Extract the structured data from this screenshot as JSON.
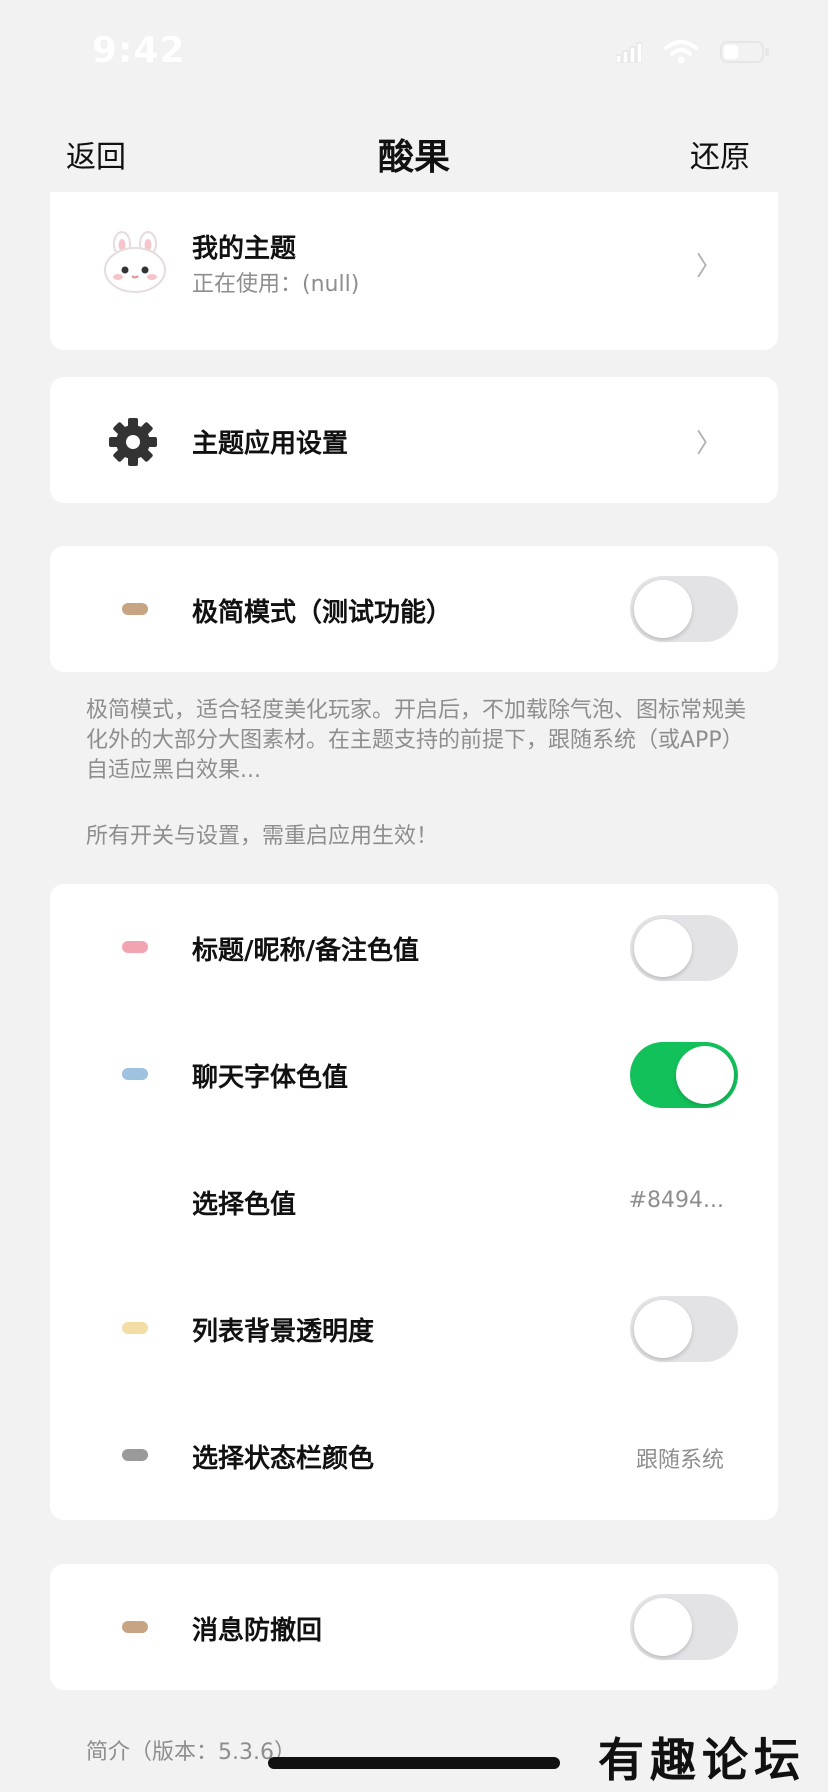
{
  "status_bar": {
    "time": "9:42"
  },
  "nav": {
    "back": "返回",
    "title": "酸果",
    "reset": "还原"
  },
  "theme_card": {
    "title": "我的主题",
    "subtitle": "正在使用：(null)"
  },
  "settings_card": {
    "title": "主题应用设置"
  },
  "minimal_card": {
    "title": "极简模式（测试功能）",
    "on": false,
    "dot_color": "#c8a582"
  },
  "minimal_desc": "极简模式，适合轻度美化玩家。开启后，不加载除气泡、图标常规美化外的大部分大图素材。在主题支持的前提下，跟随系统（或APP）自适应黑白效果...",
  "restart_note": "所有开关与设置，需重启应用生效！",
  "options": [
    {
      "label": "标题/昵称/备注色值",
      "type": "toggle",
      "on": false,
      "dot_color": "#f2a5b0"
    },
    {
      "label": "聊天字体色值",
      "type": "toggle",
      "on": true,
      "dot_color": "#9fc2e0"
    },
    {
      "label": "选择色值",
      "type": "value",
      "value": "#8494..."
    },
    {
      "label": "列表背景透明度",
      "type": "toggle",
      "on": false,
      "dot_color": "#f3dda6"
    },
    {
      "label": "选择状态栏颜色",
      "type": "value",
      "value": "跟随系统",
      "dot_color": "#9a9a9a"
    }
  ],
  "recall_card": {
    "title": "消息防撤回",
    "on": false,
    "dot_color": "#c8a582"
  },
  "footer_intro": "简介（版本：5.3.6）",
  "watermark": "有趣论坛",
  "colors": {
    "toggle_on": "#13c15a",
    "toggle_off": "#e3e3e6",
    "background": "#f2f2f2"
  }
}
